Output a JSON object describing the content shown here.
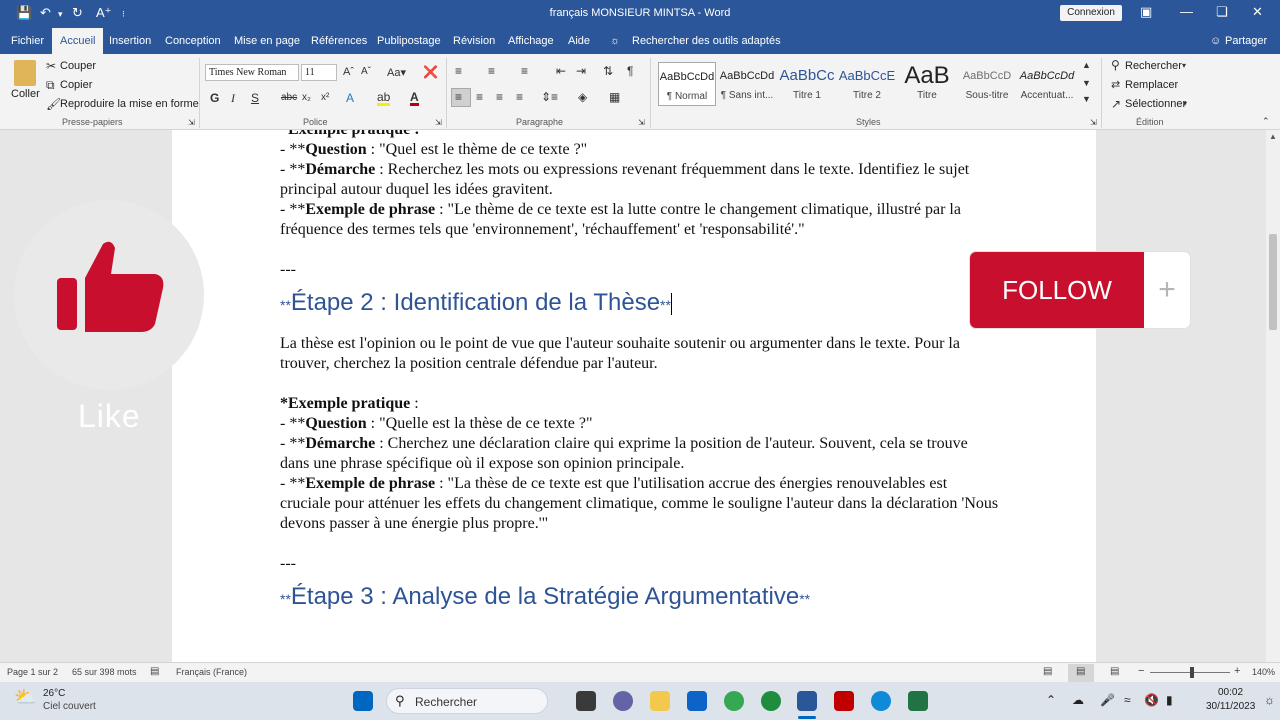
{
  "titlebar": {
    "doc_title": "français MONSIEUR MINTSA  -  Word",
    "connexion": "Connexion",
    "autosave_icon": "save-icon",
    "undo_icon": "undo-icon",
    "redo_icon": "redo-icon"
  },
  "tabs": [
    "Fichier",
    "Accueil",
    "Insertion",
    "Conception",
    "Mise en page",
    "Références",
    "Publipostage",
    "Révision",
    "Affichage",
    "Aide"
  ],
  "tell_me": "Rechercher des outils adaptés",
  "share": "Partager",
  "clipboard": {
    "coller": "Coller",
    "couper": "Couper",
    "copier": "Copier",
    "reproduire": "Reproduire la mise en forme",
    "group": "Presse-papiers"
  },
  "font": {
    "name": "Times New Roman",
    "size": "11",
    "group": "Police"
  },
  "paragraph": {
    "group": "Paragraphe"
  },
  "styles": {
    "group": "Styles",
    "items": [
      {
        "sample": "AaBbCcDd",
        "name": "¶ Normal"
      },
      {
        "sample": "AaBbCcDd",
        "name": "¶ Sans int..."
      },
      {
        "sample": "AaBbCc",
        "name": "Titre 1"
      },
      {
        "sample": "AaBbCcE",
        "name": "Titre 2"
      },
      {
        "sample": "AaB",
        "name": "Titre"
      },
      {
        "sample": "AaBbCcD",
        "name": "Sous-titre"
      },
      {
        "sample": "AaBbCcDd",
        "name": "Accentuat..."
      }
    ]
  },
  "editing": {
    "group": "Édition",
    "rechercher": "Rechercher",
    "remplacer": "Remplacer",
    "selectionner": "Sélectionner"
  },
  "document": {
    "top_partial": "*Exemple pratique :",
    "block1": [
      {
        "lead": "- **",
        "bold": "Question",
        "rest": " : \"Quel est le thème de ce texte ?\""
      },
      {
        "lead": "- **",
        "bold": "Démarche",
        "rest": " : Recherchez les mots ou expressions revenant fréquemment dans le texte. Identifiez le sujet principal autour duquel les idées gravitent."
      },
      {
        "lead": "- **",
        "bold": "Exemple de phrase",
        "rest": " : \"Le thème de ce texte est la lutte contre le changement climatique, illustré par la fréquence des termes tels que 'environnement', 'réchauffement' et 'responsabilité'.\""
      }
    ],
    "separator1": "---",
    "heading2_pre": "**",
    "heading2": "Étape 2 : Identification de la Thèse",
    "heading2_post": "**",
    "para2": "La thèse est l'opinion ou le point de vue que l'auteur souhaite soutenir ou argumenter dans le texte. Pour la trouver, cherchez la position centrale défendue par l'auteur.",
    "example2_title": "*Exemple pratique",
    "example2_colon": " :",
    "block2": [
      {
        "lead": "- **",
        "bold": "Question",
        "rest": " : \"Quelle est la thèse de ce texte ?\""
      },
      {
        "lead": "- **",
        "bold": "Démarche",
        "rest": " : Cherchez une déclaration claire qui exprime la position de l'auteur. Souvent, cela se trouve dans une phrase spécifique où il expose son opinion principale."
      },
      {
        "lead": "- **",
        "bold": "Exemple de phrase",
        "rest": " : \"La thèse de ce texte est que l'utilisation accrue des énergies renouvelables est cruciale pour atténuer les effets du changement climatique, comme le souligne l'auteur dans la déclaration 'Nous devons passer à une énergie plus propre.'\""
      }
    ],
    "separator2": "---",
    "heading3_pre": "**",
    "heading3": "Étape 3 : Analyse de la Stratégie Argumentative",
    "heading3_post": "**"
  },
  "overlay": {
    "like": "Like",
    "follow": "FOLLOW",
    "plus": "+"
  },
  "status": {
    "page": "Page 1 sur 2",
    "words": "65 sur 398 mots",
    "language": "Français (France)",
    "zoom": "140%"
  },
  "taskbar": {
    "temp": "26°C",
    "weather": "Ciel couvert",
    "search": "Rechercher",
    "time": "00:02",
    "date": "30/11/2023"
  },
  "colors": {
    "word_blue": "#2b579a",
    "follow_red": "#c8102e",
    "heading_blue": "#2f5496"
  }
}
